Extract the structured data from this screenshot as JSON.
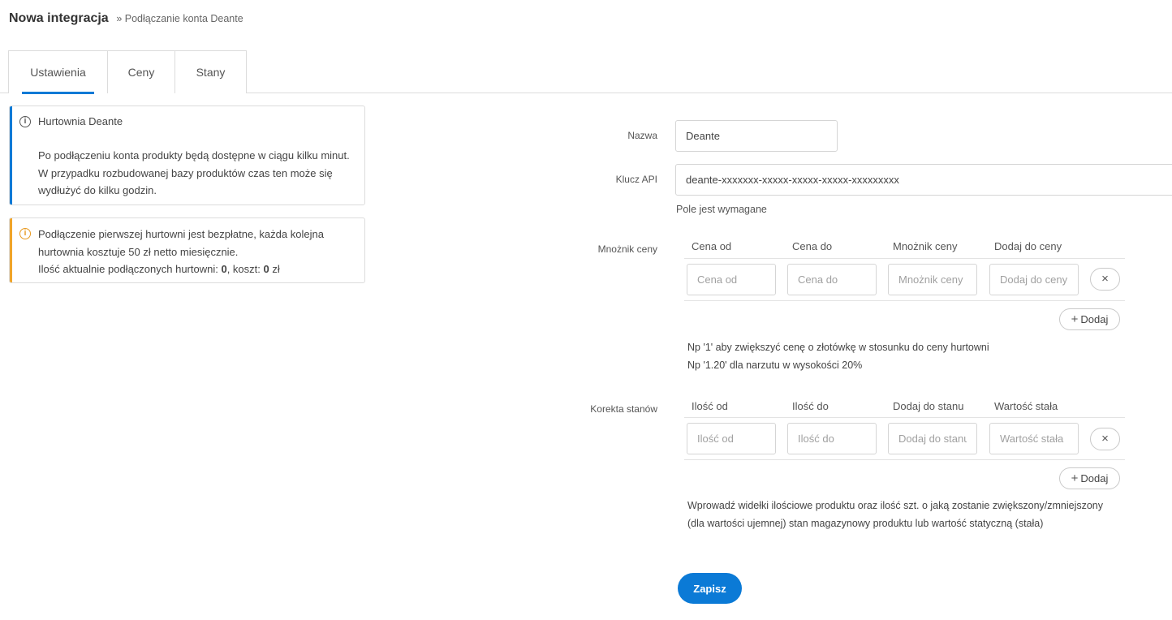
{
  "header": {
    "title": "Nowa integracja",
    "breadcrumb": "» Podłączanie konta Deante"
  },
  "tabs": [
    {
      "label": "Ustawienia",
      "active": true
    },
    {
      "label": "Ceny",
      "active": false
    },
    {
      "label": "Stany",
      "active": false
    }
  ],
  "info_alert": {
    "icon": "info-icon",
    "title": "Hurtownia Deante",
    "body": "Po podłączeniu konta produkty będą dostępne w ciągu kilku minut. W przypadku rozbudowanej bazy produktów czas ten może się wydłużyć do kilku godzin."
  },
  "warning_alert": {
    "icon": "warning-icon",
    "line1": "Podłączenie pierwszej hurtowni jest bezpłatne, każda kolejna hurtownia kosztuje 50 zł netto miesięcznie.",
    "line2_prefix": "Ilość aktualnie podłączonych hurtowni: ",
    "count": "0",
    "line2_mid": ", koszt: ",
    "cost": "0",
    "line2_suffix": " zł"
  },
  "form": {
    "name_label": "Nazwa",
    "name_value": "Deante",
    "api_key_label": "Klucz API",
    "api_key_value": "deante-xxxxxxx-xxxxx-xxxxx-xxxxx-xxxxxxxxx",
    "api_key_hint": "Pole jest wymagane",
    "price_multiplier": {
      "label": "Mnożnik ceny",
      "columns": [
        "Cena od",
        "Cena do",
        "Mnożnik ceny",
        "Dodaj do ceny"
      ],
      "placeholders": [
        "Cena od",
        "Cena do",
        "Mnożnik ceny",
        "Dodaj do ceny"
      ],
      "remove_icon": "×",
      "add_icon": "+",
      "add_label": "Dodaj",
      "note_line1": "Np '1' aby zwiększyć cenę o złotówkę w stosunku do ceny hurtowni",
      "note_line2": "Np '1.20' dla narzutu w wysokości 20%"
    },
    "stock_correction": {
      "label": "Korekta stanów",
      "columns": [
        "Ilość od",
        "Ilość do",
        "Dodaj do stanu",
        "Wartość stała"
      ],
      "placeholders": [
        "Ilość od",
        "Ilość do",
        "Dodaj do stanu",
        "Wartość stała"
      ],
      "remove_icon": "×",
      "add_icon": "+",
      "add_label": "Dodaj",
      "note": "Wprowadź widełki ilościowe produktu oraz ilość szt. o jaką zostanie zwiększony/zmniejszony (dla wartości ujemnej) stan magazynowy produktu lub wartość statyczną (stała)"
    },
    "save_label": "Zapisz"
  }
}
